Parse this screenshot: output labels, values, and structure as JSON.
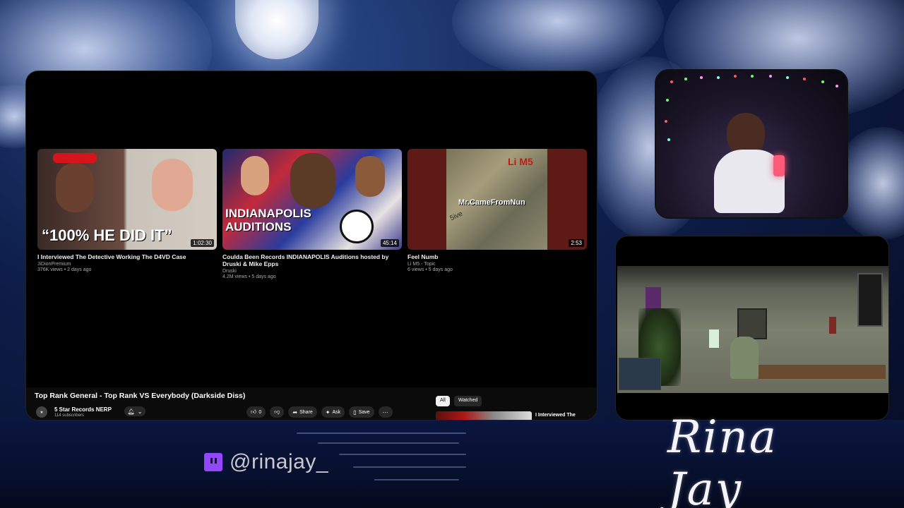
{
  "overlay": {
    "twitch_handle": "@rinajay_",
    "signature": "Rina Jay",
    "icons": [
      "twitch-icon",
      "moon-image"
    ]
  },
  "browser": {
    "video_cards": [
      {
        "title": "I Interviewed The Detective Working The D4VD Case",
        "channel": "JiDionPremium",
        "meta": "376K views • 2 days ago",
        "duration": "1:02:30",
        "thumb_text": "“100% HE DID IT”"
      },
      {
        "title": "Coulda Been Records INDIANAPOLIS Auditions hosted by Druski & Mike Epps",
        "channel": "Druski",
        "meta": "4.2M views • 5 days ago",
        "duration": "45:14",
        "thumb_text": "INDIANAPOLIS AUDITIONS"
      },
      {
        "title": "Feel Numb",
        "channel": "Li M5 - Topic",
        "meta": "6 views • 5 days ago",
        "duration": "2:53",
        "thumb_text": "Mr.CameFromNun",
        "thumb_text2": "Li M5",
        "thumb_text3": "5ive"
      }
    ],
    "now_playing": {
      "title": "Top Rank General - Top Rank VS Everybody (Darkside Diss)",
      "channel": "5 Star Records NERP",
      "subscribers": "114 subscribers",
      "likes": "0",
      "share": "Share",
      "ask": "Ask",
      "save": "Save"
    },
    "chips": {
      "all": "All",
      "watched": "Watched"
    },
    "up_next_title": "I Interviewed The"
  }
}
